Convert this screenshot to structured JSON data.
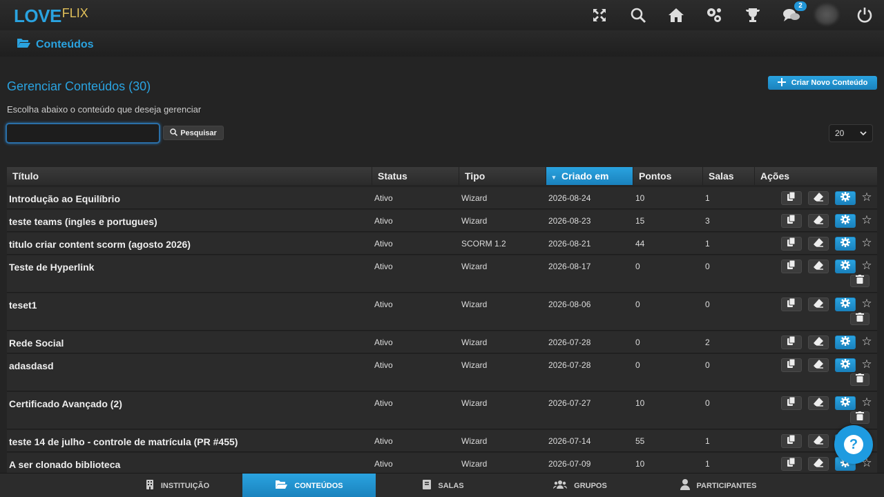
{
  "logo": {
    "part1": "LOVE",
    "part2": "FLIX"
  },
  "header": {
    "notifications_count": "2"
  },
  "breadcrumb": {
    "label": "Conteúdos"
  },
  "main": {
    "title": "Gerenciar Conteúdos (30)",
    "subtitle": "Escolha abaixo o conteúdo que deseja gerenciar",
    "new_button": "Criar Novo Conteúdo",
    "search_placeholder": "",
    "search_value": "",
    "search_button": "Pesquisar",
    "per_page": "20"
  },
  "table": {
    "columns": [
      "Título",
      "Status",
      "Tipo",
      "Criado em",
      "Pontos",
      "Salas",
      "Ações"
    ],
    "sorted_column": "Criado em",
    "rows": [
      {
        "title": "Introdução ao Equilíbrio",
        "status": "Ativo",
        "type": "Wizard",
        "created": "2026-08-24",
        "points": "10",
        "rooms": "1",
        "deletable": false
      },
      {
        "title": "teste teams (ingles e portugues)",
        "status": "Ativo",
        "type": "Wizard",
        "created": "2026-08-23",
        "points": "15",
        "rooms": "3",
        "deletable": false
      },
      {
        "title": "titulo criar content scorm (agosto 2026)",
        "status": "Ativo",
        "type": "SCORM 1.2",
        "created": "2026-08-21",
        "points": "44",
        "rooms": "1",
        "deletable": false
      },
      {
        "title": "Teste de Hyperlink",
        "status": "Ativo",
        "type": "Wizard",
        "created": "2026-08-17",
        "points": "0",
        "rooms": "0",
        "deletable": true
      },
      {
        "title": "teset1",
        "status": "Ativo",
        "type": "Wizard",
        "created": "2026-08-06",
        "points": "0",
        "rooms": "0",
        "deletable": true
      },
      {
        "title": "Rede Social",
        "status": "Ativo",
        "type": "Wizard",
        "created": "2026-07-28",
        "points": "0",
        "rooms": "2",
        "deletable": false
      },
      {
        "title": "adasdasd",
        "status": "Ativo",
        "type": "Wizard",
        "created": "2026-07-28",
        "points": "0",
        "rooms": "0",
        "deletable": true
      },
      {
        "title": "Certificado Avançado (2)",
        "status": "Ativo",
        "type": "Wizard",
        "created": "2026-07-27",
        "points": "10",
        "rooms": "0",
        "deletable": true
      },
      {
        "title": "teste 14 de julho - controle de matrícula (PR #455)",
        "status": "Ativo",
        "type": "Wizard",
        "created": "2026-07-14",
        "points": "55",
        "rooms": "1",
        "deletable": false
      },
      {
        "title": "A ser clonado biblioteca",
        "status": "Ativo",
        "type": "Wizard",
        "created": "2026-07-09",
        "points": "10",
        "rooms": "1",
        "deletable": false
      }
    ]
  },
  "bottom_nav": [
    {
      "label": "INSTITUIÇÃO",
      "icon": "building-icon",
      "active": false
    },
    {
      "label": "CONTEÚDOS",
      "icon": "folder-icon",
      "active": true
    },
    {
      "label": "SALAS",
      "icon": "book-icon",
      "active": false
    },
    {
      "label": "GRUPOS",
      "icon": "users-icon",
      "active": false
    },
    {
      "label": "PARTICIPANTES",
      "icon": "user-icon",
      "active": false
    }
  ],
  "colors": {
    "accent": "#2aa3e0",
    "logo_secondary": "#e2c15a"
  }
}
